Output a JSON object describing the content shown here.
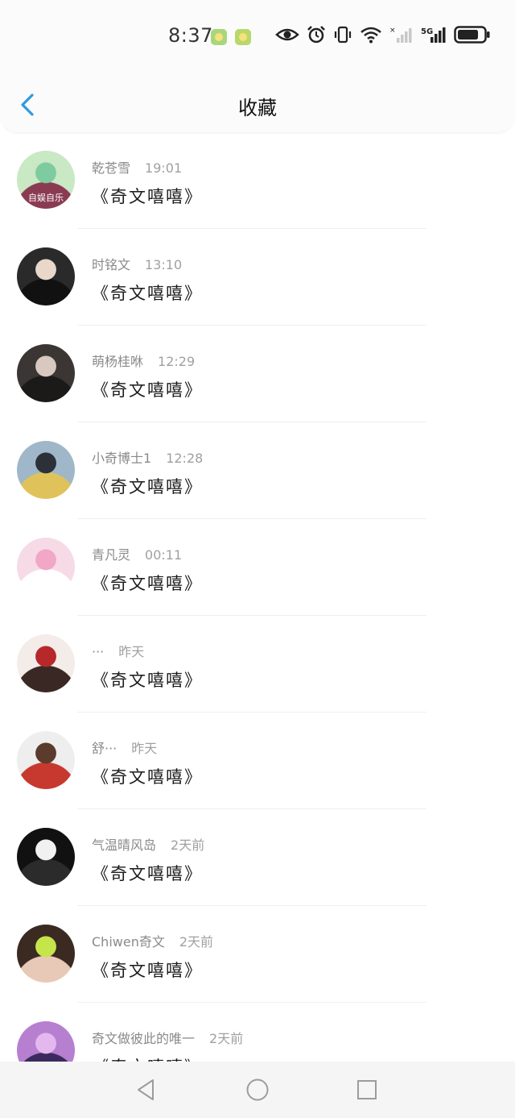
{
  "status_bar": {
    "time": "8:37",
    "network": "5G",
    "icons": [
      "app-notification-icon",
      "app-notification-icon",
      "eye-icon",
      "alarm-icon",
      "vibrate-icon",
      "wifi-icon",
      "signal-icon",
      "signal-icon",
      "battery-icon"
    ]
  },
  "header": {
    "title": "收藏",
    "back_icon": "chevron-left-icon"
  },
  "colors": {
    "accent": "#2e9be0",
    "background": "#ffffff",
    "name_text": "#8a8a8a"
  },
  "items": [
    {
      "name": "乾苍雪",
      "time": "19:01",
      "message": "《奇文嘻嘻》",
      "avatar_caption": "自娱自乐",
      "avatar_colors": [
        "#c9e8c4",
        "#7ecba0",
        "#8a3b52"
      ]
    },
    {
      "name": "时铭文",
      "time": "13:10",
      "message": "《奇文嘻嘻》",
      "avatar_colors": [
        "#2a2a2a",
        "#e9d7ca",
        "#111111"
      ]
    },
    {
      "name": "萌杨桂咻",
      "time": "12:29",
      "message": "《奇文嘻嘻》",
      "avatar_colors": [
        "#3b3634",
        "#d9c8bf",
        "#1c1a19"
      ]
    },
    {
      "name": "小奇博士1",
      "time": "12:28",
      "message": "《奇文嘻嘻》",
      "avatar_colors": [
        "#9fb7c9",
        "#2b3137",
        "#e0c25a"
      ]
    },
    {
      "name": "青凡灵",
      "time": "00:11",
      "message": "《奇文嘻嘻》",
      "avatar_colors": [
        "#f6dbe7",
        "#f2a7c6",
        "#ffffff"
      ]
    },
    {
      "name": "···",
      "time": "昨天",
      "message": "《奇文嘻嘻》",
      "avatar_colors": [
        "#f3ece8",
        "#b7282b",
        "#3a2824"
      ]
    },
    {
      "name": "舒···",
      "time": "昨天",
      "message": "《奇文嘻嘻》",
      "avatar_colors": [
        "#eeeeee",
        "#5a3b2c",
        "#c7392f"
      ]
    },
    {
      "name": "气温晴风岛",
      "time": "2天前",
      "message": "《奇文嘻嘻》",
      "avatar_colors": [
        "#111111",
        "#f1f1f1",
        "#2b2b2b"
      ]
    },
    {
      "name": "Chiwen奇文",
      "time": "2天前",
      "message": "《奇文嘻嘻》",
      "avatar_colors": [
        "#3a2a22",
        "#c6e54a",
        "#e8c9b7"
      ]
    },
    {
      "name": "奇文做彼此的唯一",
      "time": "2天前",
      "message": "《奇文嘻嘻》",
      "avatar_colors": [
        "#b77fd0",
        "#e2b8ef",
        "#3b2a5e"
      ]
    }
  ],
  "nav_bar": {
    "back_icon": "triangle-back-icon",
    "home_icon": "circle-home-icon",
    "recents_icon": "square-recents-icon"
  }
}
